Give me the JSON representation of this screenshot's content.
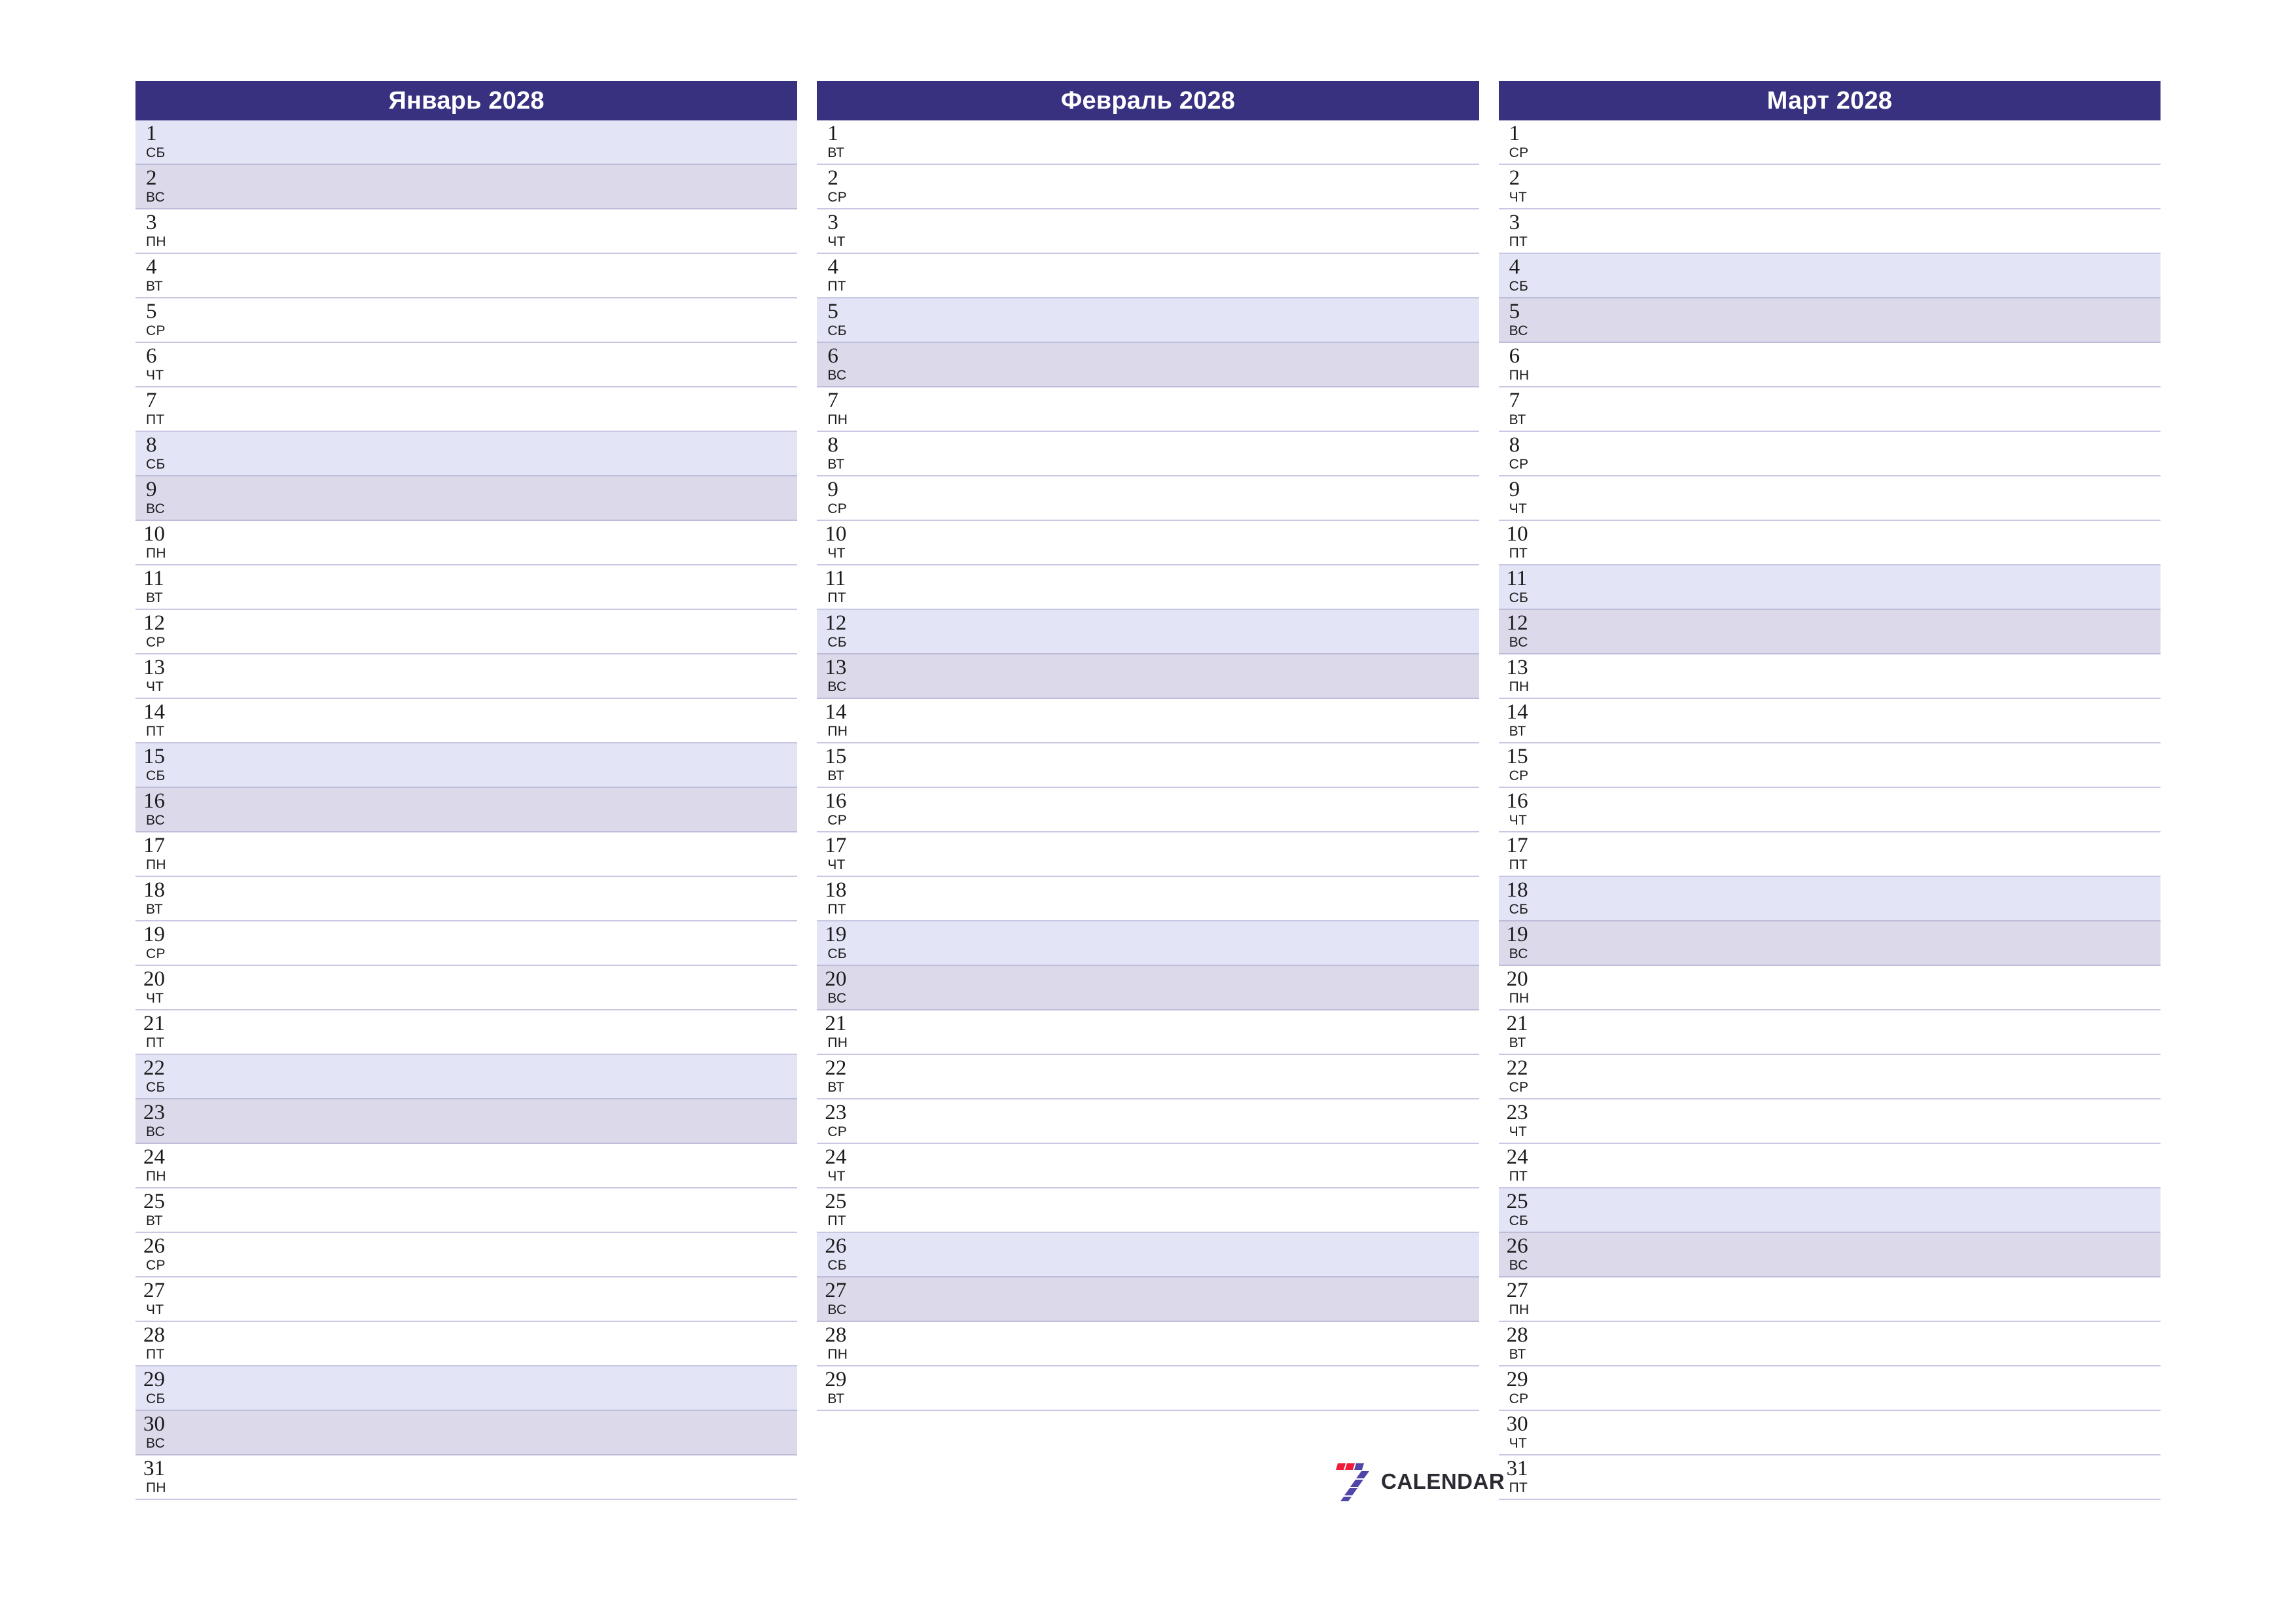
{
  "document": {
    "title": "Календарь 2028",
    "orientation": "landscape",
    "page_background": "#ffffff"
  },
  "theme": {
    "header_bg": "#373180",
    "header_text": "#ffffff",
    "saturday_bg": "#e3e4f6",
    "sunday_bg": "#dcd9ea",
    "row_border": "#c9c8e2",
    "weekend_row_border": "#bdbcd9",
    "text": "#1b1b1b"
  },
  "weekday_names": {
    "mon": "пн",
    "tue": "вт",
    "wed": "ср",
    "thu": "чт",
    "fri": "пт",
    "sat": "сб",
    "sun": "вс"
  },
  "months": [
    {
      "title": "Январь 2028",
      "name": "Январь",
      "year": "2028",
      "days": [
        {
          "num": "1",
          "wd": "сб",
          "type": "sat"
        },
        {
          "num": "2",
          "wd": "вс",
          "type": "sun"
        },
        {
          "num": "3",
          "wd": "пн",
          "type": "wd"
        },
        {
          "num": "4",
          "wd": "вт",
          "type": "wd"
        },
        {
          "num": "5",
          "wd": "ср",
          "type": "wd"
        },
        {
          "num": "6",
          "wd": "чт",
          "type": "wd"
        },
        {
          "num": "7",
          "wd": "пт",
          "type": "wd"
        },
        {
          "num": "8",
          "wd": "сб",
          "type": "sat"
        },
        {
          "num": "9",
          "wd": "вс",
          "type": "sun"
        },
        {
          "num": "10",
          "wd": "пн",
          "type": "wd"
        },
        {
          "num": "11",
          "wd": "вт",
          "type": "wd"
        },
        {
          "num": "12",
          "wd": "ср",
          "type": "wd"
        },
        {
          "num": "13",
          "wd": "чт",
          "type": "wd"
        },
        {
          "num": "14",
          "wd": "пт",
          "type": "wd"
        },
        {
          "num": "15",
          "wd": "сб",
          "type": "sat"
        },
        {
          "num": "16",
          "wd": "вс",
          "type": "sun"
        },
        {
          "num": "17",
          "wd": "пн",
          "type": "wd"
        },
        {
          "num": "18",
          "wd": "вт",
          "type": "wd"
        },
        {
          "num": "19",
          "wd": "ср",
          "type": "wd"
        },
        {
          "num": "20",
          "wd": "чт",
          "type": "wd"
        },
        {
          "num": "21",
          "wd": "пт",
          "type": "wd"
        },
        {
          "num": "22",
          "wd": "сб",
          "type": "sat"
        },
        {
          "num": "23",
          "wd": "вс",
          "type": "sun"
        },
        {
          "num": "24",
          "wd": "пн",
          "type": "wd"
        },
        {
          "num": "25",
          "wd": "вт",
          "type": "wd"
        },
        {
          "num": "26",
          "wd": "ср",
          "type": "wd"
        },
        {
          "num": "27",
          "wd": "чт",
          "type": "wd"
        },
        {
          "num": "28",
          "wd": "пт",
          "type": "wd"
        },
        {
          "num": "29",
          "wd": "сб",
          "type": "sat"
        },
        {
          "num": "30",
          "wd": "вс",
          "type": "sun"
        },
        {
          "num": "31",
          "wd": "пн",
          "type": "wd"
        }
      ]
    },
    {
      "title": "Февраль 2028",
      "name": "Февраль",
      "year": "2028",
      "days": [
        {
          "num": "1",
          "wd": "вт",
          "type": "wd"
        },
        {
          "num": "2",
          "wd": "ср",
          "type": "wd"
        },
        {
          "num": "3",
          "wd": "чт",
          "type": "wd"
        },
        {
          "num": "4",
          "wd": "пт",
          "type": "wd"
        },
        {
          "num": "5",
          "wd": "сб",
          "type": "sat"
        },
        {
          "num": "6",
          "wd": "вс",
          "type": "sun"
        },
        {
          "num": "7",
          "wd": "пн",
          "type": "wd"
        },
        {
          "num": "8",
          "wd": "вт",
          "type": "wd"
        },
        {
          "num": "9",
          "wd": "ср",
          "type": "wd"
        },
        {
          "num": "10",
          "wd": "чт",
          "type": "wd"
        },
        {
          "num": "11",
          "wd": "пт",
          "type": "wd"
        },
        {
          "num": "12",
          "wd": "сб",
          "type": "sat"
        },
        {
          "num": "13",
          "wd": "вс",
          "type": "sun"
        },
        {
          "num": "14",
          "wd": "пн",
          "type": "wd"
        },
        {
          "num": "15",
          "wd": "вт",
          "type": "wd"
        },
        {
          "num": "16",
          "wd": "ср",
          "type": "wd"
        },
        {
          "num": "17",
          "wd": "чт",
          "type": "wd"
        },
        {
          "num": "18",
          "wd": "пт",
          "type": "wd"
        },
        {
          "num": "19",
          "wd": "сб",
          "type": "sat"
        },
        {
          "num": "20",
          "wd": "вс",
          "type": "sun"
        },
        {
          "num": "21",
          "wd": "пн",
          "type": "wd"
        },
        {
          "num": "22",
          "wd": "вт",
          "type": "wd"
        },
        {
          "num": "23",
          "wd": "ср",
          "type": "wd"
        },
        {
          "num": "24",
          "wd": "чт",
          "type": "wd"
        },
        {
          "num": "25",
          "wd": "пт",
          "type": "wd"
        },
        {
          "num": "26",
          "wd": "сб",
          "type": "sat"
        },
        {
          "num": "27",
          "wd": "вс",
          "type": "sun"
        },
        {
          "num": "28",
          "wd": "пн",
          "type": "wd"
        },
        {
          "num": "29",
          "wd": "вт",
          "type": "wd"
        }
      ]
    },
    {
      "title": "Март 2028",
      "name": "Март",
      "year": "2028",
      "days": [
        {
          "num": "1",
          "wd": "ср",
          "type": "wd"
        },
        {
          "num": "2",
          "wd": "чт",
          "type": "wd"
        },
        {
          "num": "3",
          "wd": "пт",
          "type": "wd"
        },
        {
          "num": "4",
          "wd": "сб",
          "type": "sat"
        },
        {
          "num": "5",
          "wd": "вс",
          "type": "sun"
        },
        {
          "num": "6",
          "wd": "пн",
          "type": "wd"
        },
        {
          "num": "7",
          "wd": "вт",
          "type": "wd"
        },
        {
          "num": "8",
          "wd": "ср",
          "type": "wd"
        },
        {
          "num": "9",
          "wd": "чт",
          "type": "wd"
        },
        {
          "num": "10",
          "wd": "пт",
          "type": "wd"
        },
        {
          "num": "11",
          "wd": "сб",
          "type": "sat"
        },
        {
          "num": "12",
          "wd": "вс",
          "type": "sun"
        },
        {
          "num": "13",
          "wd": "пн",
          "type": "wd"
        },
        {
          "num": "14",
          "wd": "вт",
          "type": "wd"
        },
        {
          "num": "15",
          "wd": "ср",
          "type": "wd"
        },
        {
          "num": "16",
          "wd": "чт",
          "type": "wd"
        },
        {
          "num": "17",
          "wd": "пт",
          "type": "wd"
        },
        {
          "num": "18",
          "wd": "сб",
          "type": "sat"
        },
        {
          "num": "19",
          "wd": "вс",
          "type": "sun"
        },
        {
          "num": "20",
          "wd": "пн",
          "type": "wd"
        },
        {
          "num": "21",
          "wd": "вт",
          "type": "wd"
        },
        {
          "num": "22",
          "wd": "ср",
          "type": "wd"
        },
        {
          "num": "23",
          "wd": "чт",
          "type": "wd"
        },
        {
          "num": "24",
          "wd": "пт",
          "type": "wd"
        },
        {
          "num": "25",
          "wd": "сб",
          "type": "sat"
        },
        {
          "num": "26",
          "wd": "вс",
          "type": "sun"
        },
        {
          "num": "27",
          "wd": "пн",
          "type": "wd"
        },
        {
          "num": "28",
          "wd": "вт",
          "type": "wd"
        },
        {
          "num": "29",
          "wd": "ср",
          "type": "wd"
        },
        {
          "num": "30",
          "wd": "чт",
          "type": "wd"
        },
        {
          "num": "31",
          "wd": "пт",
          "type": "wd"
        }
      ]
    }
  ],
  "logo": {
    "icon": "seven-blocks-logo-icon",
    "word": "CALENDAR",
    "word_color": "#2b2b33",
    "accent_red": "#ef1b3b",
    "accent_purple": "#4f46a8"
  }
}
